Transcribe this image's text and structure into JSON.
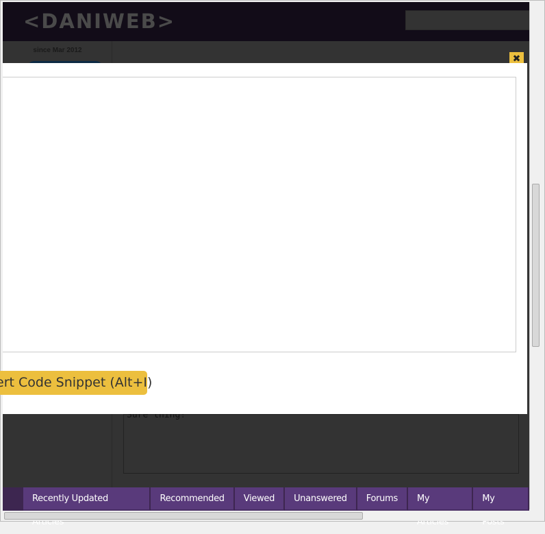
{
  "header": {
    "logo": "<DANIWEB>"
  },
  "sidebar": {
    "since": "since Mar 2012"
  },
  "reply": {
    "text": "Sure thing!"
  },
  "modal": {
    "snippet_button": "ert Code Snippet (Alt+I)",
    "close_icon": "close-x-icon"
  },
  "nav": {
    "tabs": [
      "Recently Updated Articles",
      "Recommended",
      "Viewed",
      "Unanswered",
      "Forums",
      "My Articles",
      "My Posts"
    ]
  },
  "colors": {
    "accent": "#ecbf3e",
    "nav": "#593a7b",
    "header": "#120c18"
  }
}
